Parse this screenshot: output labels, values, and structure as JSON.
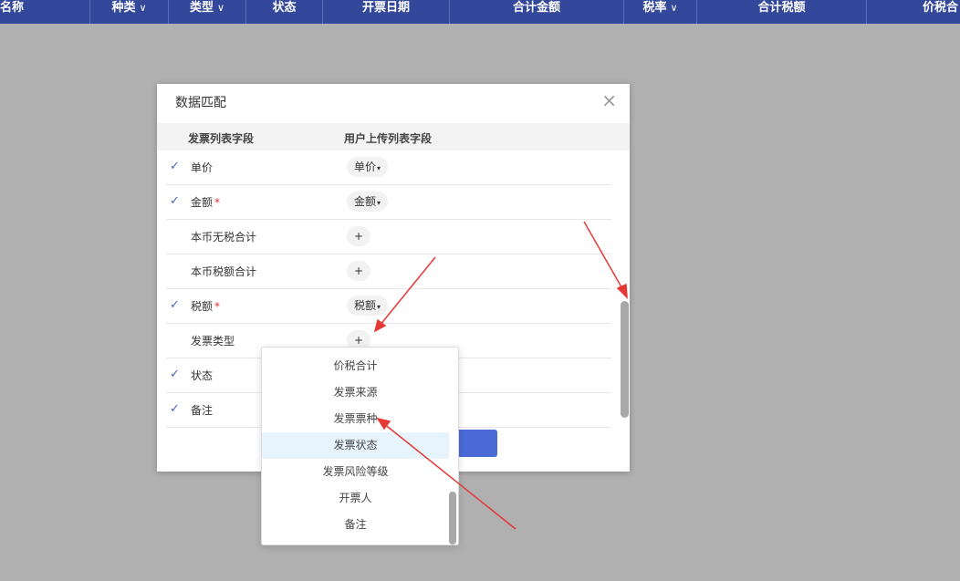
{
  "header": {
    "columns": [
      {
        "label": "名称",
        "chevron": false
      },
      {
        "label": "种类",
        "chevron": true
      },
      {
        "label": "类型",
        "chevron": true
      },
      {
        "label": "状态",
        "chevron": false
      },
      {
        "label": "开票日期",
        "chevron": false
      },
      {
        "label": "合计金额",
        "chevron": false
      },
      {
        "label": "税率",
        "chevron": true
      },
      {
        "label": "合计税额",
        "chevron": false
      },
      {
        "label": "价税合",
        "chevron": false
      }
    ]
  },
  "dialog": {
    "title": "数据匹配",
    "close_glyph": "×",
    "col_invoice": "发票列表字段",
    "col_upload": "用户上传列表字段",
    "rows": [
      {
        "checked": true,
        "label": "单价",
        "required": false,
        "mapped": "单价",
        "add": false
      },
      {
        "checked": true,
        "label": "金额",
        "required": true,
        "mapped": "金额",
        "add": false
      },
      {
        "checked": false,
        "label": "本币无税合计",
        "required": false,
        "mapped": "",
        "add": true
      },
      {
        "checked": false,
        "label": "本币税额合计",
        "required": false,
        "mapped": "",
        "add": true
      },
      {
        "checked": true,
        "label": "税额",
        "required": true,
        "mapped": "税额",
        "add": false
      },
      {
        "checked": false,
        "label": "发票类型",
        "required": false,
        "mapped": "",
        "add": true
      },
      {
        "checked": true,
        "label": "状态",
        "required": false,
        "mapped": "",
        "add": false
      },
      {
        "checked": true,
        "label": "备注",
        "required": false,
        "mapped": "",
        "add": false
      }
    ]
  },
  "dropdown": {
    "options": [
      "价税合计",
      "发票来源",
      "发票票种",
      "发票状态",
      "发票风险等级",
      "开票人",
      "备注"
    ],
    "hovered_index": 3
  },
  "colors": {
    "header_bg": "#33489a",
    "accent": "#4a6ad6",
    "annotation": "#e53935"
  }
}
